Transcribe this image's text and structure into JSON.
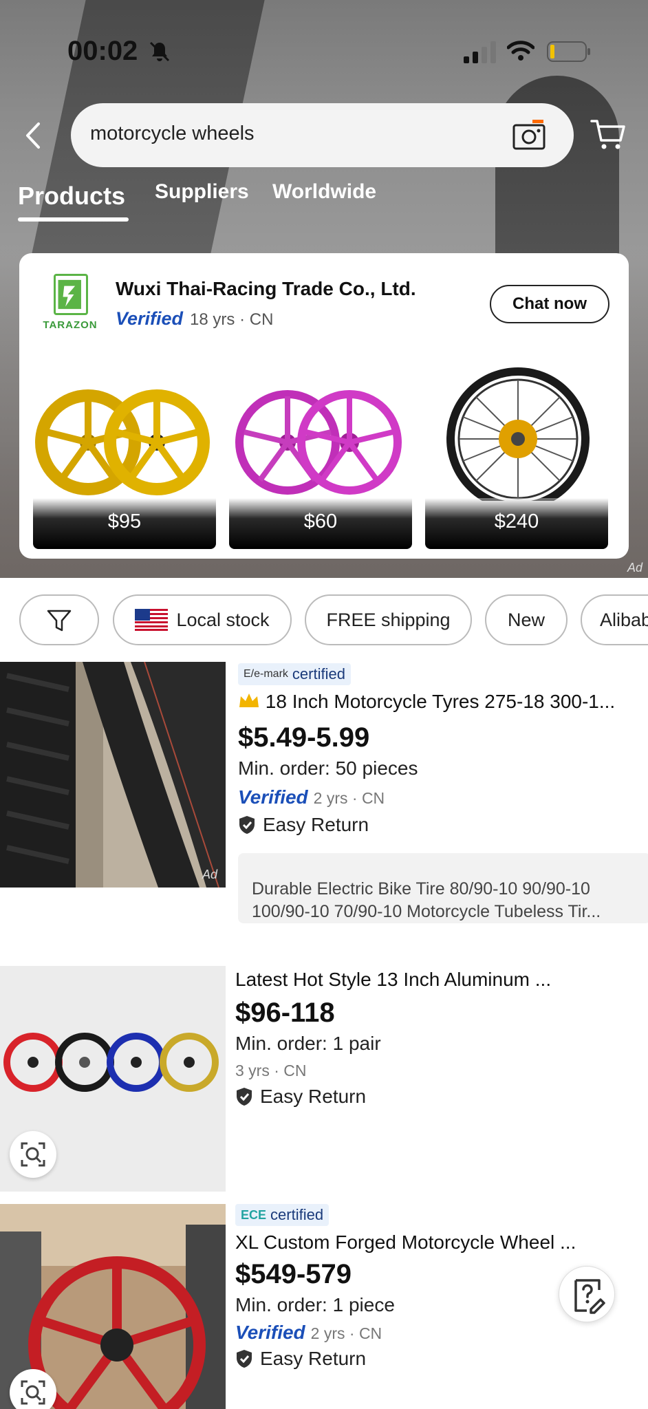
{
  "status_bar": {
    "time": "00:02"
  },
  "search": {
    "query": "motorcycle wheels"
  },
  "tabs": [
    {
      "label": "Products",
      "active": true
    },
    {
      "label": "Suppliers",
      "active": false
    },
    {
      "label": "Worldwide",
      "active": false
    }
  ],
  "ad_card": {
    "logo_text": "TARAZON",
    "company": "Wuxi Thai-Racing Trade Co., Ltd.",
    "verified_label": "Verified",
    "years_country": "18 yrs · CN",
    "chat_label": "Chat now",
    "products": [
      {
        "price": "$95",
        "color": "#d4a500"
      },
      {
        "price": "$60",
        "color": "#c02fb8"
      },
      {
        "price": "$240",
        "color": "#e0a000"
      }
    ],
    "ad_tag": "Ad"
  },
  "filters": [
    {
      "label": "",
      "icon": "filter-icon"
    },
    {
      "label": "Local stock",
      "icon": "us-flag-icon"
    },
    {
      "label": "FREE shipping"
    },
    {
      "label": "New"
    },
    {
      "label": "Alibaba"
    }
  ],
  "products": [
    {
      "badge_small": "E/e-mark",
      "badge_label": "certified",
      "title": "18 Inch Motorcycle Tyres 275-18 300-1...",
      "price": "$5.49-5.99",
      "moq": "Min. order: 50 pieces",
      "verified_label": "Verified",
      "years_country": "2 yrs · CN",
      "return_label": "Easy Return",
      "ad_tag": "Ad",
      "description": "Durable Electric Bike Tire  80/90-10 90/90-10 100/90-10 70/90-10 Motorcycle Tubeless Tir..."
    },
    {
      "title": "Latest Hot Style 13 Inch Aluminum ...",
      "price": "$96-118",
      "moq": "Min. order: 1 pair",
      "years_country": "3 yrs · CN",
      "return_label": "Easy Return"
    },
    {
      "badge_small": "ECE",
      "badge_label": "certified",
      "title": "XL Custom Forged Motorcycle Wheel ...",
      "price": "$549-579",
      "moq": "Min. order: 1 piece",
      "verified_label": "Verified",
      "years_country": "2 yrs · CN",
      "return_label": "Easy Return"
    }
  ],
  "colors": {
    "verified_blue": "#1b4fb8",
    "crown": "#f2b400"
  }
}
